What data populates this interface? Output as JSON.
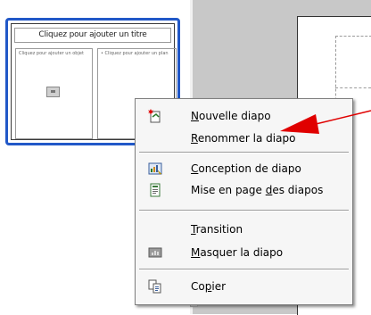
{
  "thumbnail": {
    "title": "Cliquez pour ajouter un titre",
    "left_text": "Cliquez pour ajouter un objet",
    "right_text": "• Cliquez pour ajouter un plan"
  },
  "menu": {
    "items": [
      {
        "label": "Nouvelle diapo",
        "underline": "N",
        "icon": "new-slide-icon"
      },
      {
        "label": "Renommer la diapo",
        "underline": "R",
        "icon": ""
      },
      {
        "label": "Conception de diapo",
        "underline": "C",
        "icon": "slide-design-icon"
      },
      {
        "label": "Mise en page des diapos",
        "underline": "d",
        "icon": "slide-layout-icon"
      },
      {
        "label": "Transition",
        "underline": "T",
        "icon": ""
      },
      {
        "label": "Masquer la diapo",
        "underline": "M",
        "icon": "hide-slide-icon"
      },
      {
        "label": "Copier",
        "underline": "p",
        "icon": "copy-icon"
      }
    ]
  },
  "colors": {
    "selection_border": "#2158c8",
    "annotation_arrow": "#e00000",
    "workspace_gray": "#c8c8c8"
  }
}
